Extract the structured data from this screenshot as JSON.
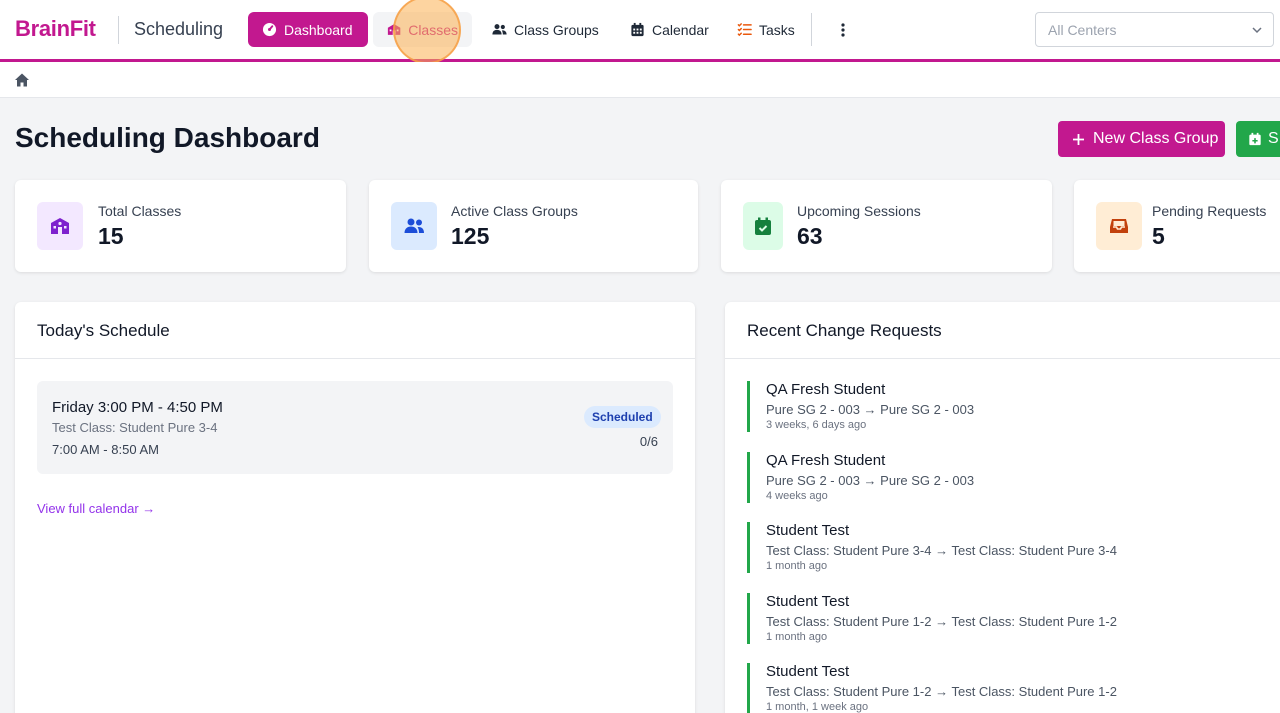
{
  "header": {
    "brand": "BrainFit",
    "app_title": "Scheduling",
    "nav": {
      "dashboard": "Dashboard",
      "classes": "Classes",
      "class_groups": "Class Groups",
      "calendar": "Calendar",
      "tasks": "Tasks"
    },
    "center_select": {
      "value": "All Centers"
    }
  },
  "page": {
    "title": "Scheduling Dashboard",
    "actions": {
      "new_class_group": "New Class Group",
      "second_action": "S"
    }
  },
  "stats": [
    {
      "label": "Total Classes",
      "value": "15",
      "icon": "school-icon",
      "color": "#7e22ce"
    },
    {
      "label": "Active Class Groups",
      "value": "125",
      "icon": "users-icon",
      "color": "#1d4ed8"
    },
    {
      "label": "Upcoming Sessions",
      "value": "63",
      "icon": "calendar-check-icon",
      "color": "#15803d"
    },
    {
      "label": "Pending Requests",
      "value": "5",
      "icon": "inbox-icon",
      "color": "#c2410c"
    }
  ],
  "todays_schedule": {
    "title": "Today's Schedule",
    "sessions": [
      {
        "time": "Friday 3:00 PM - 4:50 PM",
        "class_name": "Test Class: Student Pure 3-4",
        "hours": "7:00 AM - 8:50 AM",
        "status": "Scheduled",
        "enrollment": "0/6"
      }
    ],
    "view_calendar": "View full calendar →"
  },
  "change_requests": {
    "title": "Recent Change Requests",
    "items": [
      {
        "student": "QA Fresh Student",
        "change": "Pure SG 2 - 003 → Pure SG 2 - 003",
        "time": "3 weeks, 6 days ago"
      },
      {
        "student": "QA Fresh Student",
        "change": "Pure SG 2 - 003 → Pure SG 2 - 003",
        "time": "4 weeks ago"
      },
      {
        "student": "Student Test",
        "change": "Test Class: Student Pure 3-4 → Test Class: Student Pure 3-4",
        "time": "1 month ago"
      },
      {
        "student": "Student Test",
        "change": "Test Class: Student Pure 1-2 → Test Class: Student Pure 1-2",
        "time": "1 month ago"
      },
      {
        "student": "Student Test",
        "change": "Test Class: Student Pure 1-2 → Test Class: Student Pure 1-2",
        "time": "1 month, 1 week ago"
      }
    ]
  },
  "colors": {
    "brand": "#c2188f",
    "success": "#22a74a",
    "link": "#9333ea"
  }
}
